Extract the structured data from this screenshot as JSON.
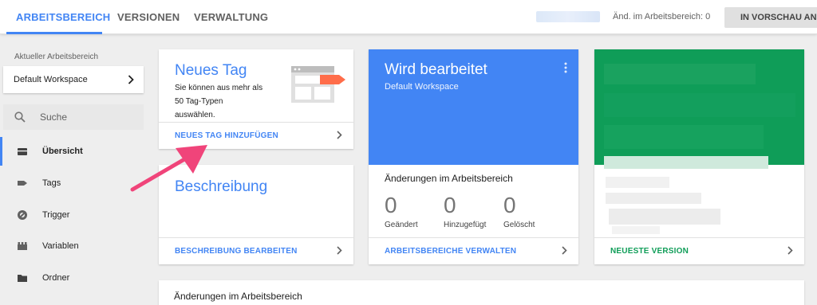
{
  "topbar": {
    "tabs": [
      {
        "label": "ARBEITSBEREICH",
        "active": true
      },
      {
        "label": "VERSIONEN",
        "active": false
      },
      {
        "label": "VERWALTUNG",
        "active": false
      }
    ],
    "changes_count": "Änd. im Arbeitsbereich: 0",
    "preview_button": "IN VORSCHAU ANSEHEN",
    "accent": "#4285f4"
  },
  "sidebar": {
    "current_ws_label": "Aktueller Arbeitsbereich",
    "workspace_name": "Default Workspace",
    "search_placeholder": "Suche",
    "items": [
      {
        "label": "Übersicht",
        "icon": "briefcase-icon",
        "active": true
      },
      {
        "label": "Tags",
        "icon": "tag-icon",
        "active": false
      },
      {
        "label": "Trigger",
        "icon": "trigger-icon",
        "active": false
      },
      {
        "label": "Variablen",
        "icon": "variables-icon",
        "active": false
      },
      {
        "label": "Ordner",
        "icon": "folder-icon",
        "active": false
      }
    ]
  },
  "new_tag_card": {
    "title": "Neues Tag",
    "description_lines": [
      "Sie können aus mehr als",
      "50 Tag-Typen",
      "auswählen."
    ],
    "link": "NEUES TAG HINZUFÜGEN"
  },
  "description_card": {
    "title": "Beschreibung",
    "link": "BESCHREIBUNG BEARBEITEN"
  },
  "workspace_card": {
    "title": "Wird bearbeitet",
    "subtitle": "Default Workspace",
    "changes_title": "Änderungen im Arbeitsbereich",
    "stats": [
      {
        "value": "0",
        "label": "Geändert"
      },
      {
        "value": "0",
        "label": "Hinzugefügt"
      },
      {
        "value": "0",
        "label": "Gelöscht"
      }
    ],
    "link": "ARBEITSBEREICHE VERWALTEN"
  },
  "version_card": {
    "link": "NEUESTE VERSION",
    "accent": "#0f9d58"
  },
  "bottom_card": {
    "title": "Änderungen im Arbeitsbereich"
  }
}
